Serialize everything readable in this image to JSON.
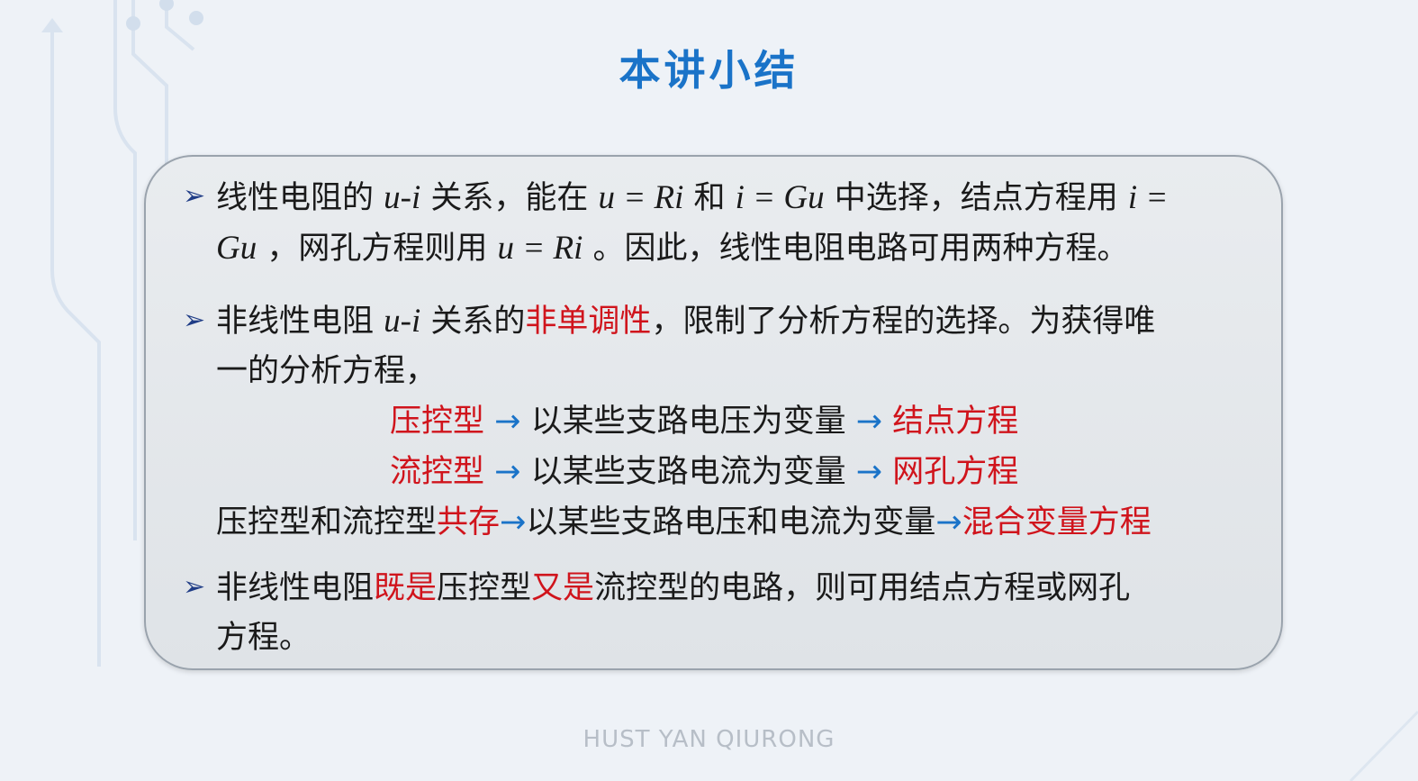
{
  "title": "本讲小结",
  "footer": "HUST YAN QIURONG",
  "bullets": {
    "b1": {
      "l1a": "线性电阻的 ",
      "l1b": "u-i",
      "l1c": " 关系，能在 ",
      "l1d": "u = Ri",
      "l1e": " 和 ",
      "l1f": "i = Gu",
      "l1g": " 中选择，结点方程用 ",
      "l1h": "i =",
      "l2a": "Gu",
      "l2b": " ，网孔方程则用 ",
      "l2c": "u = Ri",
      "l2d": " 。因此，线性电阻电路可用两种方程。"
    },
    "b2": {
      "l1a": "非线性电阻 ",
      "l1b": "u-i",
      "l1c": " 关系的",
      "l1d": "非单调性",
      "l1e": "，限制了分析方程的选择。为获得唯",
      "l2": "一的分析方程，",
      "r1": {
        "type": "压控型",
        "arrow1": "→",
        "desc": " 以某些支路电压为变量 ",
        "arrow2": "→",
        "eq": " 结点方程"
      },
      "r2": {
        "type": "流控型",
        "arrow1": "→",
        "desc": " 以某些支路电流为变量 ",
        "arrow2": "→",
        "eq": " 网孔方程"
      },
      "r3": {
        "a": "压控型和流控型",
        "b": "共存",
        "arrow1": "→",
        "c": "以某些支路电压和电流为变量",
        "arrow2": "→",
        "d": "混合变量方程"
      }
    },
    "b3": {
      "l1a": "非线性电阻",
      "l1b": "既是",
      "l1c": "压控型",
      "l1d": "又是",
      "l1e": "流控型的电路，则可用结点方程或网孔",
      "l2": "方程。"
    }
  },
  "colors": {
    "title": "#1a73c8",
    "highlight": "#d0141c",
    "arrow": "#1a73c8",
    "bullet": "#1f3c86"
  }
}
